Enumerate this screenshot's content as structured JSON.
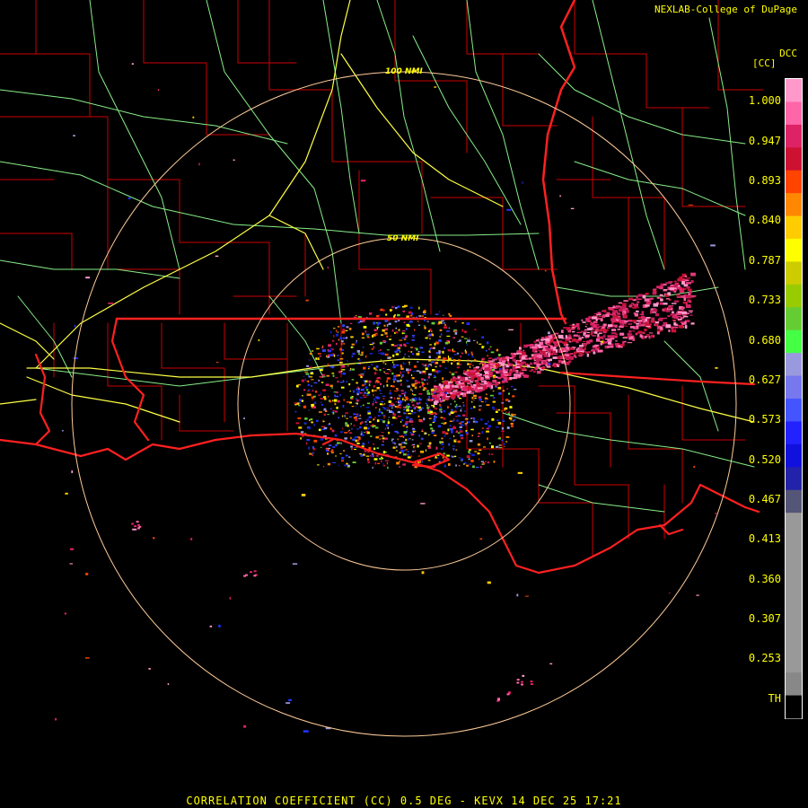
{
  "credit": "NEXLAB-College of DuPage",
  "site_code": "DCC",
  "product_title": "CORRELATION COEFFICIENT (CC) 0.5 DEG - KEVX 14 DEC 25 17:21",
  "range_rings": [
    {
      "label": "50 NMI"
    },
    {
      "label": "100 NMI"
    }
  ],
  "color_scale": {
    "units": "[CC]",
    "labels": [
      "1.000",
      "0.947",
      "0.893",
      "0.840",
      "0.787",
      "0.733",
      "0.680",
      "0.627",
      "0.573",
      "0.520",
      "0.467",
      "0.413",
      "0.360",
      "0.307",
      "0.253",
      "TH"
    ],
    "colors": [
      "#ff99cc",
      "#ff66aa",
      "#dd2266",
      "#cc1133",
      "#ff4400",
      "#ff8800",
      "#ffcc00",
      "#ffff00",
      "#cccc00",
      "#99cc00",
      "#66cc33",
      "#44ff44",
      "#9999dd",
      "#7777ee",
      "#4455ff",
      "#2222ff",
      "#1111dd",
      "#2222aa",
      "#555577",
      "#999999",
      "#999999",
      "#999999",
      "#999999",
      "#999999",
      "#999999",
      "#999999",
      "#888888",
      "#000000"
    ]
  },
  "map_colors": {
    "state_border": "#ff2020",
    "county_border": "#cc0000",
    "highway": "#ffff44",
    "road": "#88ee88",
    "range_ring": "#ffcc99"
  }
}
